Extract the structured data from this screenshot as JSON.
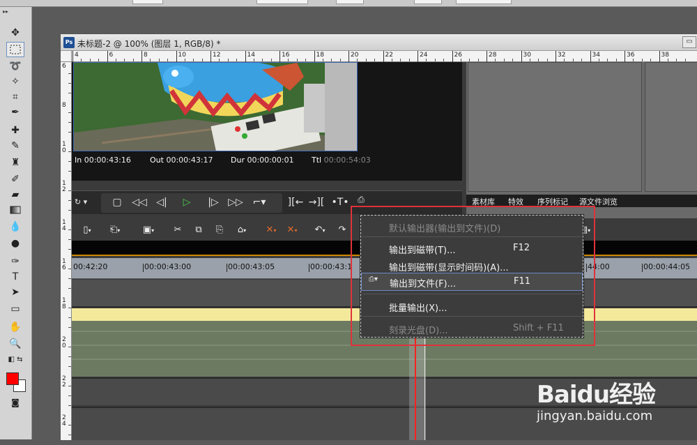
{
  "document": {
    "title": "未标题-2 @ 100% (图层 1, RGB/8) *",
    "app_icon": "Ps",
    "restore_icon": "restore-icon"
  },
  "rulers": {
    "horizontal": [
      "4",
      "6",
      "8",
      "10",
      "12",
      "14",
      "16",
      "18",
      "20",
      "22",
      "24",
      "26",
      "28",
      "30",
      "32",
      "34",
      "36",
      "38"
    ],
    "vertical": [
      "6",
      "8",
      "1\n0",
      "1\n2",
      "1\n4",
      "1\n6",
      "1\n8",
      "2\n0",
      "2\n2",
      "2\n4"
    ]
  },
  "tools": [
    "move-tool-icon",
    "marquee-tool-icon",
    "lasso-tool-icon",
    "magic-wand-icon",
    "crop-tool-icon",
    "eyedropper-icon",
    "healing-brush-icon",
    "brush-tool-icon",
    "clone-stamp-icon",
    "history-brush-icon",
    "eraser-icon",
    "gradient-icon",
    "blur-icon",
    "dodge-icon",
    "pen-tool-icon",
    "type-tool-icon",
    "path-select-icon",
    "shape-tool-icon",
    "hand-tool-icon",
    "zoom-tool-icon"
  ],
  "colors": {
    "foreground": "#ff0000",
    "background": "#ffffff",
    "accent": "#e0323a"
  },
  "preview": {
    "in_label": "In",
    "in_value": "00:00:43:16",
    "out_label": "Out",
    "out_value": "00:00:43:17",
    "dur_label": "Dur",
    "dur_value": "00:00:00:01",
    "ttl_label": "Ttl",
    "ttl_value": "00:00:54:03"
  },
  "right_panel": {
    "tabs": [
      "素材库",
      "特效",
      "序列标记",
      "源文件浏览"
    ]
  },
  "timeline": {
    "ruler_labels": [
      "00:42:20",
      "00:00:43:00",
      "00:00:43:05",
      "00:00:43:1",
      "44:00",
      "00:00:44:05"
    ]
  },
  "context_menu": {
    "items": [
      {
        "label": "默认输出器(输出到文件)(D)",
        "shortcut": "",
        "disabled": true
      },
      {
        "label": "输出到磁带(T)...",
        "shortcut": "F12",
        "disabled": false
      },
      {
        "label": "输出到磁带(显示时间码)(A)...",
        "shortcut": "",
        "disabled": false
      },
      {
        "label": "输出到文件(F)...",
        "shortcut": "F11",
        "disabled": false,
        "highlighted": true
      },
      {
        "label": "批量输出(X)...",
        "shortcut": "",
        "disabled": false
      },
      {
        "label": "刻录光盘(D)...",
        "shortcut": "Shift + F11",
        "disabled": true
      }
    ]
  },
  "watermark": {
    "logo": "Baidu经验",
    "url": "jingyan.baidu.com"
  }
}
